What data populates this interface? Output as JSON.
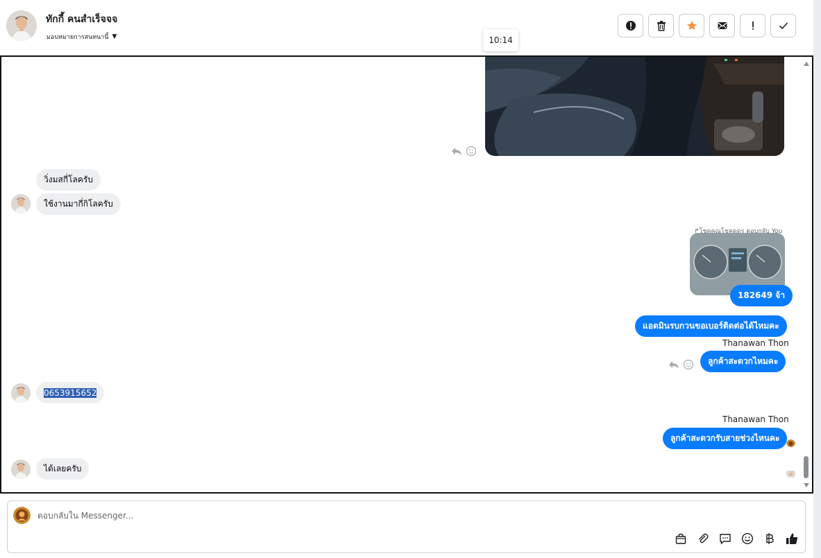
{
  "header": {
    "contact_name": "ทักกี้ คนสำเร็จจจ",
    "assign_label": "มอบหมายการสนทนานี้",
    "tooltip_time": "10:14",
    "toolbar": [
      {
        "icon": "alert-circle-icon",
        "label": "Mark as spam"
      },
      {
        "icon": "trash-icon",
        "label": "Delete"
      },
      {
        "icon": "star-icon",
        "label": "Star"
      },
      {
        "icon": "mail-icon",
        "label": "Mark as unread"
      },
      {
        "icon": "exclamation-icon",
        "label": "Follow up"
      },
      {
        "icon": "check-icon",
        "label": "Done"
      }
    ]
  },
  "messages": {
    "incoming_1": "วิ่งมสกี่โลครับ",
    "incoming_2": "ใช้งานมากี่กิโลครับ",
    "reply_meta": "โชคคูณโชคดูดร ตอบกลับ You",
    "outgoing_mileage": "182649 จ้า",
    "outgoing_request_phone": "แอดมินรบกวนขอเบอร์ติดต่อได้ไหมคะ",
    "sender_name_1": "Thanawan Thon",
    "outgoing_convenient": "ลูกค้าสะดวกไหมคะ",
    "incoming_phone": "0653915652",
    "sender_name_2": "Thanawan Thon",
    "outgoing_time": "ลูกค้าสะดวกรับสายช่วงไหนคะ",
    "incoming_ok": "ได้เลยครับ"
  },
  "composer": {
    "placeholder": "ตอบกลับใน Messenger...",
    "icons": [
      "bag-icon",
      "paperclip-icon",
      "chat-bubble-icon",
      "emoji-icon",
      "baht-icon",
      "thumbs-up-icon"
    ]
  },
  "colors": {
    "accent": "#0a7cff",
    "incoming_bubble": "#eeeff1",
    "star": "#f7923a"
  }
}
